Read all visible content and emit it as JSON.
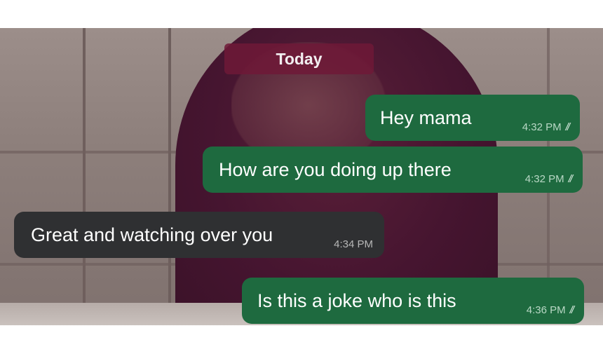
{
  "date_separator": "Today",
  "messages": [
    {
      "direction": "outgoing",
      "text": "Hey mama",
      "time": "4:32 PM",
      "status_icon": "double-check-icon",
      "status_glyph": "//"
    },
    {
      "direction": "outgoing",
      "text": "How are you doing up there",
      "time": "4:32 PM",
      "status_icon": "double-check-icon",
      "status_glyph": "//"
    },
    {
      "direction": "incoming",
      "text": "Great and watching over you",
      "time": "4:34 PM"
    },
    {
      "direction": "outgoing",
      "text": "Is this a joke who is this",
      "time": "4:36 PM",
      "status_icon": "double-check-icon",
      "status_glyph": "//"
    }
  ],
  "colors": {
    "outgoing_bubble": "#1e6a3f",
    "incoming_bubble": "#2f3032",
    "date_chip": "#6e1937"
  }
}
